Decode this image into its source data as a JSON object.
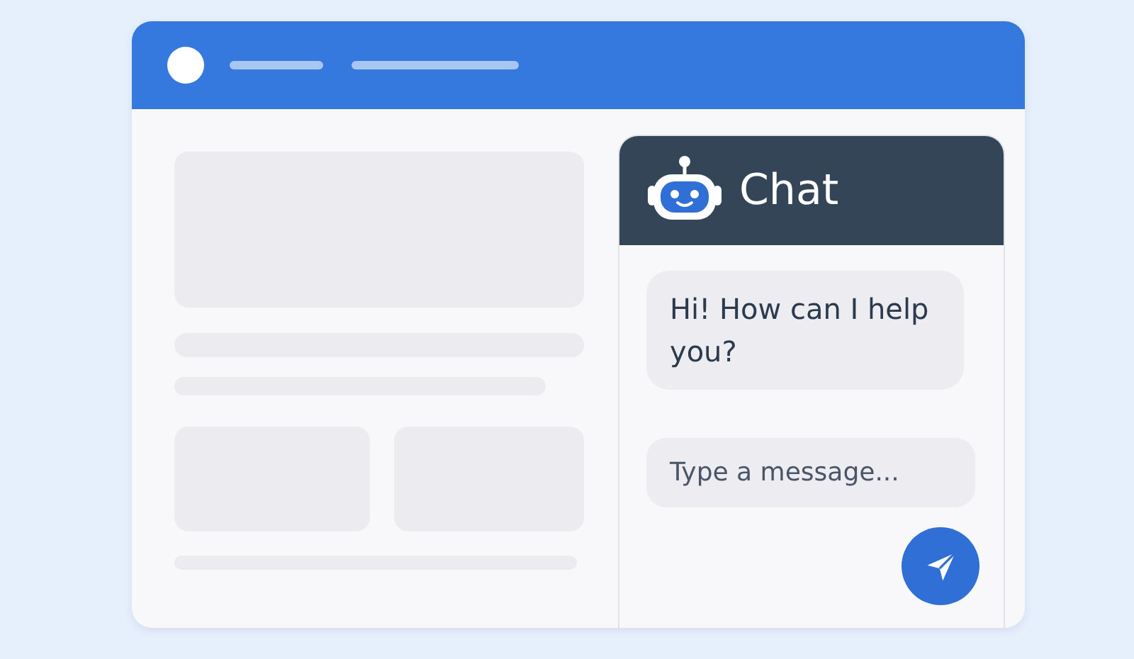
{
  "chat": {
    "title": "Chat",
    "messages": [
      {
        "text": "Hi! How can I help you?"
      }
    ],
    "input": {
      "placeholder": "Type a message..."
    }
  }
}
